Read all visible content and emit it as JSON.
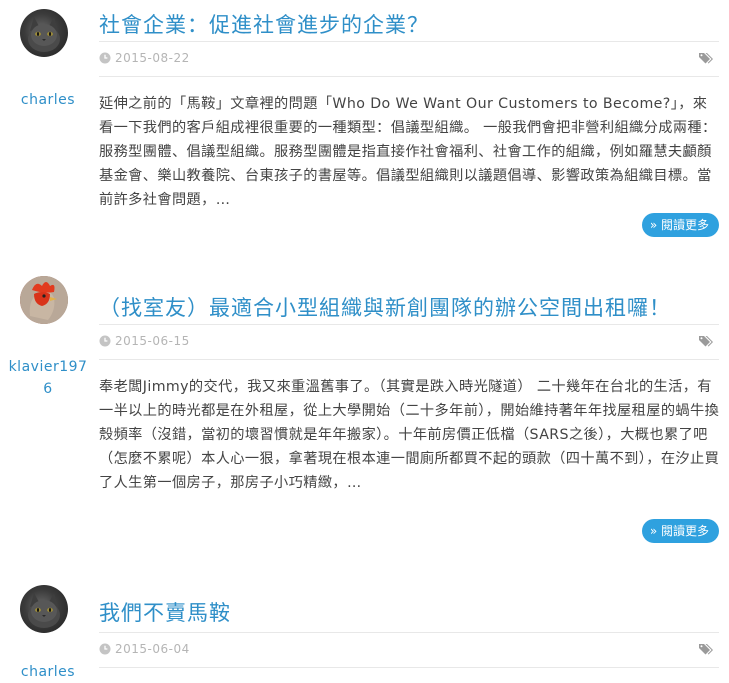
{
  "posts": [
    {
      "author": "charles",
      "title": "社會企業：促進社會進步的企業？",
      "date": "2015-08-22",
      "excerpt": "延伸之前的「馬鞍」文章裡的問題「Who Do We Want Our Customers to Become?」，來看一下我們的客戶組成裡很重要的一種類型：倡議型組織。 一般我們會把非營利組織分成兩種：服務型團體、倡議型組織。服務型團體是指直接作社會福利、社會工作的組織，例如羅慧夫顱顏基金會、樂山教養院、台東孩子的書屋等。倡議型組織則以議題倡導、影響政策為組織目標。當前許多社會問題，…",
      "more_label": "» 閱讀更多",
      "avatar_icon": "cat-avatar"
    },
    {
      "author": "klavier1976",
      "title": "（找室友）最適合小型組織與新創團隊的辦公空間出租囉！",
      "date": "2015-06-15",
      "excerpt": "奉老闆Jimmy的交代，我又來重溫舊事了。（其實是跌入時光隧道） 二十幾年在台北的生活，有一半以上的時光都是在外租屋，從上大學開始（二十多年前），開始維持著年年找屋租屋的蝸牛換殼頻率（沒錯，當初的壞習慣就是年年搬家）。十年前房價正低檔（SARS之後），大概也累了吧（怎麼不累呢）本人心一狠，拿著現在根本連一間廁所都買不起的頭款（四十萬不到），在汐止買了人生第一個房子，那房子小巧精緻，…",
      "more_label": "» 閱讀更多",
      "avatar_icon": "rooster-avatar"
    },
    {
      "author": "charles",
      "title": "我們不賣馬鞍",
      "date": "2015-06-04",
      "avatar_icon": "cat-avatar"
    }
  ],
  "icons": {
    "date": "clock-icon",
    "tags": "tags-icon"
  },
  "colors": {
    "accent": "#2f8fc8",
    "button": "#2fa1df",
    "meta_text": "#b5b5b5"
  }
}
